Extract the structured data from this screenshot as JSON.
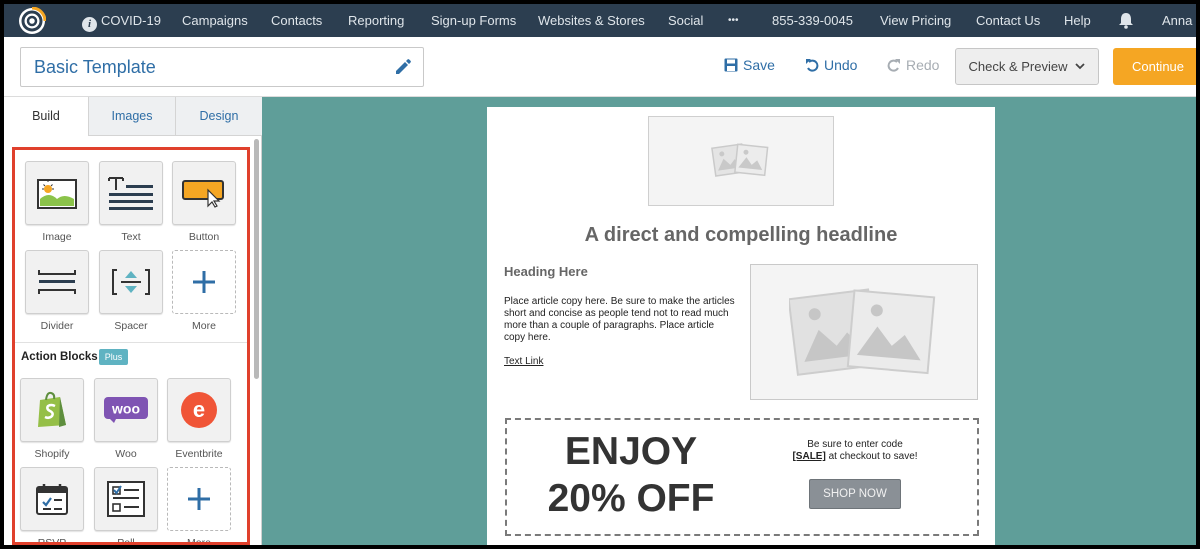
{
  "nav": {
    "covid": "COVID-19",
    "campaigns": "Campaigns",
    "contacts": "Contacts",
    "reporting": "Reporting",
    "signup_forms": "Sign-up Forms",
    "websites_stores": "Websites & Stores",
    "social": "Social",
    "more": "•••",
    "phone": "855-339-0045",
    "view_pricing": "View Pricing",
    "contact_us": "Contact Us",
    "help": "Help",
    "user": "Anna"
  },
  "toolbar": {
    "title_value": "Basic Template",
    "save": "Save",
    "undo": "Undo",
    "redo": "Redo",
    "check_preview": "Check & Preview",
    "continue": "Continue"
  },
  "sidebar": {
    "tabs": [
      "Build",
      "Images",
      "Design"
    ],
    "blocks": [
      "Image",
      "Text",
      "Button",
      "Divider",
      "Spacer",
      "More"
    ],
    "action_title": "Action Blocks",
    "plus_badge": "Plus",
    "action_blocks": [
      "Shopify",
      "Woo",
      "Eventbrite",
      "RSVP",
      "Poll",
      "More"
    ]
  },
  "email": {
    "headline": "A direct and compelling headline",
    "heading": "Heading Here",
    "article": "Place article copy here. Be sure to make the articles short and concise as people tend not to read much more than a couple of paragraphs. Place article copy here.",
    "text_link": "Text Link",
    "coupon_line1": "ENJOY",
    "coupon_line2": "20% OFF",
    "code_intro": "Be sure to enter code",
    "code": "[SALE]",
    "code_outro": " at checkout to save!",
    "shop_now": "SHOP NOW"
  },
  "colors": {
    "nav_bg": "#2c3e50",
    "canvas_bg": "#5f9e99",
    "accent_blue": "#2f6ea6",
    "continue_orange": "#f5a623",
    "highlight_red": "#e0402c",
    "plus_badge": "#5fb3c2"
  },
  "icons": {
    "logo": "constant-contact-logo-icon",
    "info": "info-icon",
    "bell": "bell-icon",
    "pencil": "pencil-icon",
    "save": "floppy-disk-icon",
    "undo": "undo-icon",
    "redo": "redo-icon",
    "chevron": "chevron-down-icon"
  }
}
